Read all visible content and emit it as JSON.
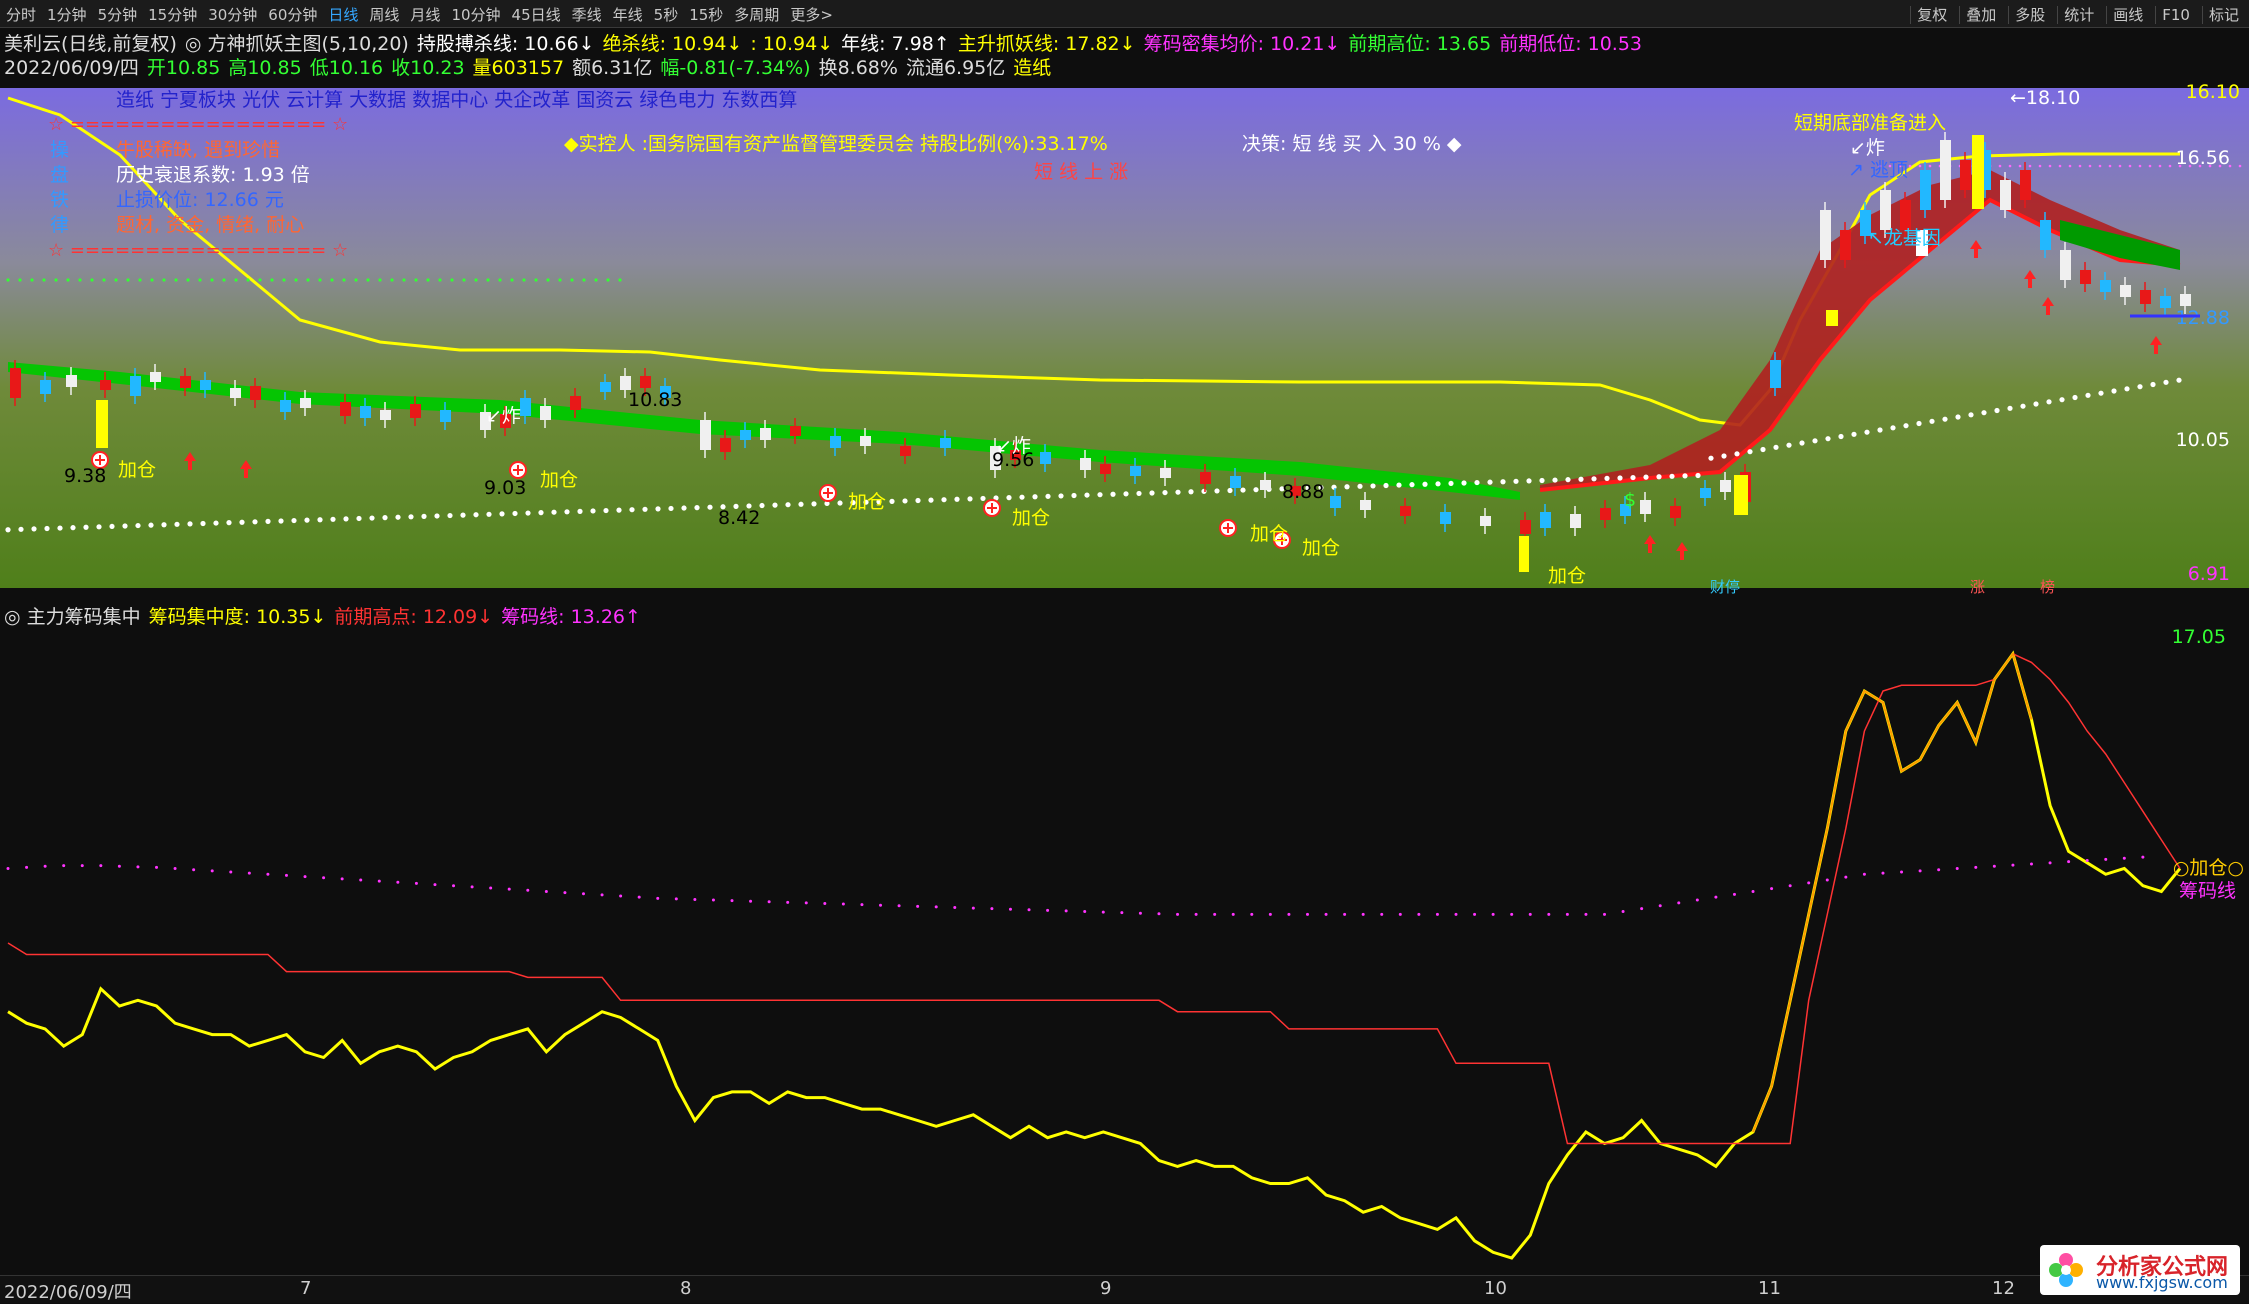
{
  "topbar": {
    "timeframes": [
      "分时",
      "1分钟",
      "5分钟",
      "15分钟",
      "30分钟",
      "60分钟",
      "日线",
      "周线",
      "月线",
      "10分钟",
      "45日线",
      "季线",
      "年线",
      "5秒",
      "15秒",
      "多周期",
      "更多>"
    ],
    "active_timeframe": "日线",
    "right_buttons": [
      "复权",
      "叠加",
      "多股",
      "统计",
      "画线",
      "F10",
      "标记"
    ]
  },
  "info1": {
    "stock": "美利云(日线,前复权)",
    "indicator": "方神抓妖主图(5,10,20)",
    "items": [
      {
        "text": "持股搏杀线: 10.66↓",
        "color": "#ffffff"
      },
      {
        "text": "绝杀线: 10.94↓",
        "color": "#ffff00"
      },
      {
        "text": ": 10.94↓",
        "color": "#ffff00"
      },
      {
        "text": "年线: 7.98↑",
        "color": "#ffffff"
      },
      {
        "text": "主升抓妖线: 17.82↓",
        "color": "#ffff00"
      },
      {
        "text": "筹码密集均价: 10.21↓",
        "color": "#ff33ff"
      },
      {
        "text": "前期高位: 13.65",
        "color": "#33ff33"
      },
      {
        "text": "前期低位: 10.53",
        "color": "#ff33ff"
      }
    ]
  },
  "info2": {
    "items": [
      {
        "text": "2022/06/09/四",
        "color": "#dddddd"
      },
      {
        "text": "开10.85",
        "color": "#33ff33"
      },
      {
        "text": "高10.85",
        "color": "#33ff33"
      },
      {
        "text": "低10.16",
        "color": "#33ff33"
      },
      {
        "text": "收10.23",
        "color": "#33ff33"
      },
      {
        "text": "量603157",
        "color": "#ffff00"
      },
      {
        "text": "额6.31亿",
        "color": "#dddddd"
      },
      {
        "text": "幅-0.81(-7.34%)",
        "color": "#33ff33"
      },
      {
        "text": "换8.68%",
        "color": "#dddddd"
      },
      {
        "text": "流通6.95亿",
        "color": "#dddddd"
      },
      {
        "text": "造纸",
        "color": "#ffff00"
      }
    ]
  },
  "main_overlay": {
    "sectors": "造纸 宁夏板块 光伏 云计算 大数据 数据中心 央企改革 国资云 绿色电力 东数西算",
    "star_line": "☆ ================= ☆",
    "left_rows": [
      {
        "k": "操",
        "v": "牛股稀缺, 遇到珍惜",
        "kc": "#3399ff",
        "vc": "#ff6633"
      },
      {
        "k": "盘",
        "v": "历史衰退系数:     1.93 倍",
        "kc": "#3399ff",
        "vc": "#ffffff"
      },
      {
        "k": "铁",
        "v": "止损价位:     12.66 元",
        "kc": "#3399ff",
        "vc": "#3366ff"
      },
      {
        "k": "律",
        "v": "题材, 资金, 情绪, 耐心",
        "kc": "#3399ff",
        "vc": "#ff6633"
      }
    ],
    "controller": "◆实控人 :国务院国有资产监督管理委员会 持股比例(%):33.17%",
    "trend": "短 线 上 涨",
    "decision": "决策: 短 线 买 入 30 % ◆",
    "bottom_signal": "短期底部准备进入",
    "right_labels": [
      {
        "text": "16.10",
        "color": "#ffff00"
      },
      {
        "text": "16.56",
        "color": "#ffffff"
      },
      {
        "text": "12.88",
        "color": "#3399ff"
      },
      {
        "text": "10.05",
        "color": "#ffffff"
      },
      {
        "text": "6.91",
        "color": "#ff33ff"
      }
    ],
    "price_labels": [
      {
        "text": "9.38",
        "color": "#000000"
      },
      {
        "text": "9.03",
        "color": "#000000"
      },
      {
        "text": "10.83",
        "color": "#000000"
      },
      {
        "text": "8.42",
        "color": "#000000"
      },
      {
        "text": "9.56",
        "color": "#000000"
      },
      {
        "text": "8.88",
        "color": "#000000"
      },
      {
        "text": "18.10",
        "color": "#ffffff"
      }
    ],
    "add_label": "加仓",
    "explode_label": "炸",
    "escape_label": "逃顶",
    "gene_label": "龙基因",
    "dollar": "$",
    "bottom_markers": [
      "财停",
      "涨",
      "榜"
    ]
  },
  "sublegend": {
    "title": "主力筹码集中",
    "items": [
      {
        "text": "筹码集中度: 10.35↓",
        "color": "#ffff00"
      },
      {
        "text": "前期高点: 12.09↓",
        "color": "#ff3333"
      },
      {
        "text": "筹码线: 13.26↑",
        "color": "#ff33ff"
      }
    ],
    "top_value": "17.05",
    "right_add": "○加仓○",
    "right_chip": "筹码线"
  },
  "chart_data": {
    "type": "line",
    "title": "主力筹码集中",
    "x_ticks": [
      "2022/06/09/四",
      "7",
      "8",
      "9",
      "10",
      "11",
      "12"
    ],
    "series": [
      {
        "name": "筹码集中度",
        "color": "#ffff00",
        "values": [
          10.8,
          10.6,
          10.5,
          10.2,
          10.4,
          11.2,
          10.9,
          11.0,
          10.9,
          10.6,
          10.5,
          10.4,
          10.4,
          10.2,
          10.3,
          10.4,
          10.1,
          10.0,
          10.3,
          9.9,
          10.1,
          10.2,
          10.1,
          9.8,
          10.0,
          10.1,
          10.3,
          10.4,
          10.5,
          10.1,
          10.4,
          10.6,
          10.8,
          10.7,
          10.5,
          10.3,
          9.5,
          8.9,
          9.3,
          9.4,
          9.4,
          9.2,
          9.4,
          9.3,
          9.3,
          9.2,
          9.1,
          9.1,
          9.0,
          8.9,
          8.8,
          8.9,
          9.0,
          8.8,
          8.6,
          8.8,
          8.6,
          8.7,
          8.6,
          8.7,
          8.6,
          8.5,
          8.2,
          8.1,
          8.2,
          8.1,
          8.1,
          7.9,
          7.8,
          7.8,
          7.9,
          7.6,
          7.5,
          7.3,
          7.4,
          7.2,
          7.1,
          7.0,
          7.2,
          6.8,
          6.6,
          6.5,
          6.9,
          7.8,
          8.3,
          8.7,
          8.5,
          8.6,
          8.9,
          8.5,
          8.4,
          8.3,
          8.1,
          8.5,
          8.7,
          9.5,
          11.0,
          12.5,
          14.0,
          15.7,
          16.4,
          16.2,
          15.0,
          15.2,
          15.8,
          16.2,
          15.5,
          16.6,
          17.05,
          15.9,
          14.4,
          13.6,
          13.4,
          13.2,
          13.3,
          13.0,
          12.9,
          13.3
        ]
      },
      {
        "name": "前期高点",
        "color": "#ff3333",
        "values": [
          12.0,
          11.8,
          11.8,
          11.8,
          11.8,
          11.8,
          11.8,
          11.8,
          11.8,
          11.8,
          11.8,
          11.8,
          11.8,
          11.8,
          11.8,
          11.5,
          11.5,
          11.5,
          11.5,
          11.5,
          11.5,
          11.5,
          11.5,
          11.5,
          11.5,
          11.5,
          11.5,
          11.5,
          11.4,
          11.4,
          11.4,
          11.4,
          11.4,
          11.0,
          11.0,
          11.0,
          11.0,
          11.0,
          11.0,
          11.0,
          11.0,
          11.0,
          11.0,
          11.0,
          11.0,
          11.0,
          11.0,
          11.0,
          11.0,
          11.0,
          11.0,
          11.0,
          11.0,
          11.0,
          11.0,
          11.0,
          11.0,
          11.0,
          11.0,
          11.0,
          11.0,
          11.0,
          11.0,
          10.8,
          10.8,
          10.8,
          10.8,
          10.8,
          10.8,
          10.5,
          10.5,
          10.5,
          10.5,
          10.5,
          10.5,
          10.5,
          10.5,
          10.5,
          9.9,
          9.9,
          9.9,
          9.9,
          9.9,
          9.9,
          8.5,
          8.5,
          8.5,
          8.5,
          8.5,
          8.5,
          8.5,
          8.5,
          8.5,
          8.5,
          8.5,
          8.5,
          8.5,
          11.0,
          12.5,
          14.0,
          15.7,
          16.4,
          16.5,
          16.5,
          16.5,
          16.5,
          16.5,
          16.6,
          17.05,
          16.9,
          16.6,
          16.2,
          15.7,
          15.3,
          14.8,
          14.3,
          13.8,
          13.3
        ]
      },
      {
        "name": "筹码线",
        "color": "#ff33ff",
        "dotted": true,
        "values": [
          13.3,
          13.32,
          13.34,
          13.35,
          13.35,
          13.35,
          13.34,
          13.33,
          13.32,
          13.3,
          13.28,
          13.26,
          13.24,
          13.22,
          13.2,
          13.18,
          13.16,
          13.14,
          13.12,
          13.1,
          13.08,
          13.06,
          13.04,
          13.02,
          13.0,
          12.98,
          12.96,
          12.94,
          12.92,
          12.9,
          12.88,
          12.86,
          12.84,
          12.82,
          12.8,
          12.78,
          12.77,
          12.76,
          12.75,
          12.74,
          12.73,
          12.72,
          12.71,
          12.7,
          12.69,
          12.68,
          12.67,
          12.66,
          12.65,
          12.64,
          12.63,
          12.62,
          12.61,
          12.6,
          12.59,
          12.58,
          12.57,
          12.56,
          12.55,
          12.54,
          12.53,
          12.52,
          12.51,
          12.5,
          12.5,
          12.5,
          12.5,
          12.5,
          12.5,
          12.5,
          12.5,
          12.5,
          12.5,
          12.5,
          12.5,
          12.5,
          12.5,
          12.5,
          12.5,
          12.5,
          12.5,
          12.5,
          12.5,
          12.5,
          12.5,
          12.5,
          12.5,
          12.55,
          12.6,
          12.65,
          12.7,
          12.75,
          12.8,
          12.85,
          12.9,
          12.95,
          13.0,
          13.05,
          13.1,
          13.15,
          13.2,
          13.22,
          13.24,
          13.26,
          13.28,
          13.3,
          13.32,
          13.34,
          13.36,
          13.38,
          13.4,
          13.42,
          13.44,
          13.46,
          13.48,
          13.5
        ]
      }
    ],
    "ylim": [
      6.5,
      17.5
    ]
  },
  "logo": {
    "name": "分析家公式网",
    "url": "www.fxjgsw.com"
  }
}
